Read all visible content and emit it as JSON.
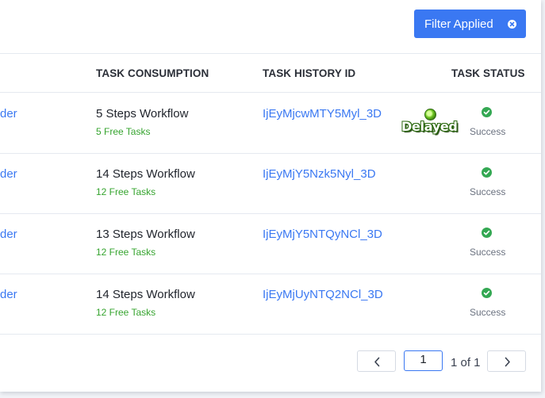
{
  "filter": {
    "label": "Filter Applied"
  },
  "columns": {
    "task_consumption": "TASK CONSUMPTION",
    "task_history_id": "TASK HISTORY ID",
    "task_status": "TASK STATUS"
  },
  "rows": [
    {
      "name_fragment": "der",
      "workflow": "5 Steps Workflow",
      "free_tasks": "5 Free Tasks",
      "history_id": "IjEyMjcwMTY5Myl_3D",
      "status": "Success"
    },
    {
      "name_fragment": "der",
      "workflow": "14 Steps Workflow",
      "free_tasks": "12 Free Tasks",
      "history_id": "IjEyMjY5Nzk5Nyl_3D",
      "status": "Success"
    },
    {
      "name_fragment": "der",
      "workflow": "13 Steps Workflow",
      "free_tasks": "12 Free Tasks",
      "history_id": "IjEyMjY5NTQyNCl_3D",
      "status": "Success"
    },
    {
      "name_fragment": "der",
      "workflow": "14 Steps Workflow",
      "free_tasks": "12 Free Tasks",
      "history_id": "IjEyMjUyNTQ2NCl_3D",
      "status": "Success"
    }
  ],
  "overlay": {
    "label": "Delayed"
  },
  "pagination": {
    "current_page": "1",
    "page_of": "1 of 1"
  },
  "colors": {
    "accent": "#3a78f2",
    "success": "#34a853",
    "free_tasks": "#36a42f"
  }
}
